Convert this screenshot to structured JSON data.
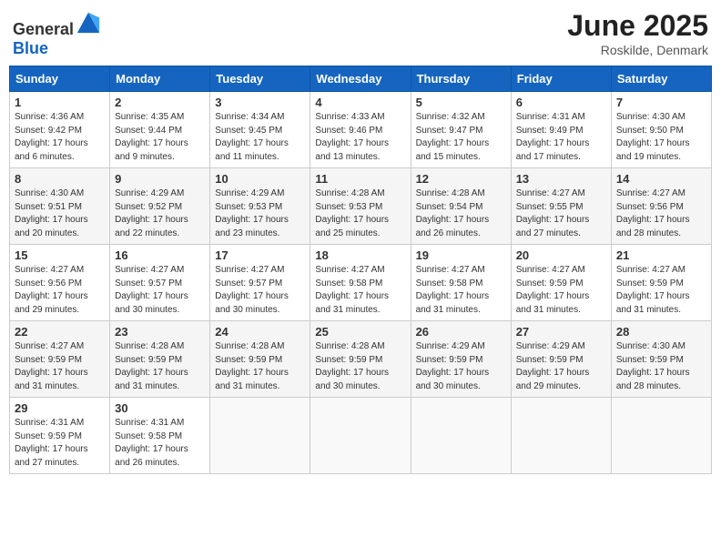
{
  "header": {
    "logo_general": "General",
    "logo_blue": "Blue",
    "month_title": "June 2025",
    "location": "Roskilde, Denmark"
  },
  "days_of_week": [
    "Sunday",
    "Monday",
    "Tuesday",
    "Wednesday",
    "Thursday",
    "Friday",
    "Saturday"
  ],
  "weeks": [
    [
      {
        "day": "1",
        "sunrise": "4:36 AM",
        "sunset": "9:42 PM",
        "daylight": "17 hours and 6 minutes."
      },
      {
        "day": "2",
        "sunrise": "4:35 AM",
        "sunset": "9:44 PM",
        "daylight": "17 hours and 9 minutes."
      },
      {
        "day": "3",
        "sunrise": "4:34 AM",
        "sunset": "9:45 PM",
        "daylight": "17 hours and 11 minutes."
      },
      {
        "day": "4",
        "sunrise": "4:33 AM",
        "sunset": "9:46 PM",
        "daylight": "17 hours and 13 minutes."
      },
      {
        "day": "5",
        "sunrise": "4:32 AM",
        "sunset": "9:47 PM",
        "daylight": "17 hours and 15 minutes."
      },
      {
        "day": "6",
        "sunrise": "4:31 AM",
        "sunset": "9:49 PM",
        "daylight": "17 hours and 17 minutes."
      },
      {
        "day": "7",
        "sunrise": "4:30 AM",
        "sunset": "9:50 PM",
        "daylight": "17 hours and 19 minutes."
      }
    ],
    [
      {
        "day": "8",
        "sunrise": "4:30 AM",
        "sunset": "9:51 PM",
        "daylight": "17 hours and 20 minutes."
      },
      {
        "day": "9",
        "sunrise": "4:29 AM",
        "sunset": "9:52 PM",
        "daylight": "17 hours and 22 minutes."
      },
      {
        "day": "10",
        "sunrise": "4:29 AM",
        "sunset": "9:53 PM",
        "daylight": "17 hours and 23 minutes."
      },
      {
        "day": "11",
        "sunrise": "4:28 AM",
        "sunset": "9:53 PM",
        "daylight": "17 hours and 25 minutes."
      },
      {
        "day": "12",
        "sunrise": "4:28 AM",
        "sunset": "9:54 PM",
        "daylight": "17 hours and 26 minutes."
      },
      {
        "day": "13",
        "sunrise": "4:27 AM",
        "sunset": "9:55 PM",
        "daylight": "17 hours and 27 minutes."
      },
      {
        "day": "14",
        "sunrise": "4:27 AM",
        "sunset": "9:56 PM",
        "daylight": "17 hours and 28 minutes."
      }
    ],
    [
      {
        "day": "15",
        "sunrise": "4:27 AM",
        "sunset": "9:56 PM",
        "daylight": "17 hours and 29 minutes."
      },
      {
        "day": "16",
        "sunrise": "4:27 AM",
        "sunset": "9:57 PM",
        "daylight": "17 hours and 30 minutes."
      },
      {
        "day": "17",
        "sunrise": "4:27 AM",
        "sunset": "9:57 PM",
        "daylight": "17 hours and 30 minutes."
      },
      {
        "day": "18",
        "sunrise": "4:27 AM",
        "sunset": "9:58 PM",
        "daylight": "17 hours and 31 minutes."
      },
      {
        "day": "19",
        "sunrise": "4:27 AM",
        "sunset": "9:58 PM",
        "daylight": "17 hours and 31 minutes."
      },
      {
        "day": "20",
        "sunrise": "4:27 AM",
        "sunset": "9:59 PM",
        "daylight": "17 hours and 31 minutes."
      },
      {
        "day": "21",
        "sunrise": "4:27 AM",
        "sunset": "9:59 PM",
        "daylight": "17 hours and 31 minutes."
      }
    ],
    [
      {
        "day": "22",
        "sunrise": "4:27 AM",
        "sunset": "9:59 PM",
        "daylight": "17 hours and 31 minutes."
      },
      {
        "day": "23",
        "sunrise": "4:28 AM",
        "sunset": "9:59 PM",
        "daylight": "17 hours and 31 minutes."
      },
      {
        "day": "24",
        "sunrise": "4:28 AM",
        "sunset": "9:59 PM",
        "daylight": "17 hours and 31 minutes."
      },
      {
        "day": "25",
        "sunrise": "4:28 AM",
        "sunset": "9:59 PM",
        "daylight": "17 hours and 30 minutes."
      },
      {
        "day": "26",
        "sunrise": "4:29 AM",
        "sunset": "9:59 PM",
        "daylight": "17 hours and 30 minutes."
      },
      {
        "day": "27",
        "sunrise": "4:29 AM",
        "sunset": "9:59 PM",
        "daylight": "17 hours and 29 minutes."
      },
      {
        "day": "28",
        "sunrise": "4:30 AM",
        "sunset": "9:59 PM",
        "daylight": "17 hours and 28 minutes."
      }
    ],
    [
      {
        "day": "29",
        "sunrise": "4:31 AM",
        "sunset": "9:59 PM",
        "daylight": "17 hours and 27 minutes."
      },
      {
        "day": "30",
        "sunrise": "4:31 AM",
        "sunset": "9:58 PM",
        "daylight": "17 hours and 26 minutes."
      },
      null,
      null,
      null,
      null,
      null
    ]
  ],
  "labels": {
    "sunrise": "Sunrise:",
    "sunset": "Sunset:",
    "daylight": "Daylight:"
  }
}
